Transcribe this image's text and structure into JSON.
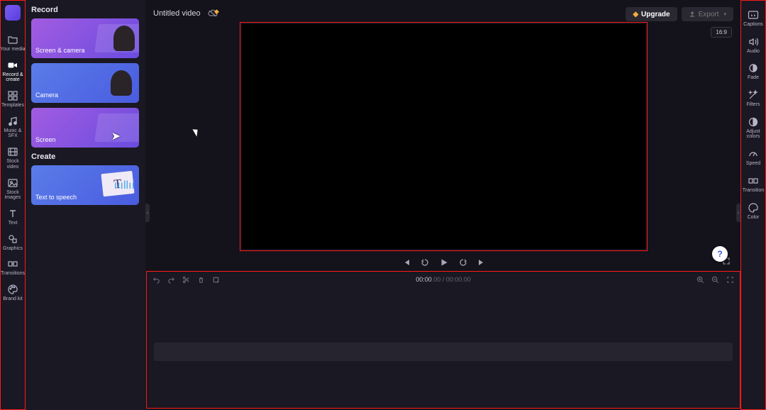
{
  "left_nav": {
    "items": [
      {
        "label": "Your media"
      },
      {
        "label": "Record & create"
      },
      {
        "label": "Templates"
      },
      {
        "label": "Music & SFX"
      },
      {
        "label": "Stock video"
      },
      {
        "label": "Stock images"
      },
      {
        "label": "Text"
      },
      {
        "label": "Graphics"
      },
      {
        "label": "Transitions"
      },
      {
        "label": "Brand kit"
      }
    ],
    "active_index": 1
  },
  "record_panel": {
    "heading_record": "Record",
    "heading_create": "Create",
    "screen_camera": "Screen & camera",
    "camera": "Camera",
    "screen": "Screen",
    "text_to_speech": "Text to speech"
  },
  "header": {
    "title": "Untitled video",
    "upgrade_label": "Upgrade",
    "export_label": "Export",
    "aspect_ratio": "16:9"
  },
  "right_nav": {
    "items": [
      {
        "label": "Captions"
      },
      {
        "label": "Audio"
      },
      {
        "label": "Fade"
      },
      {
        "label": "Filters"
      },
      {
        "label": "Adjust colors"
      },
      {
        "label": "Speed"
      },
      {
        "label": "Transition"
      },
      {
        "label": "Color"
      }
    ]
  },
  "timeline": {
    "current_mmss": "00:00",
    "current_ms": ".00",
    "separator": " / ",
    "total_mmss": "00:00",
    "total_ms": ".00"
  },
  "help": {
    "label": "?"
  },
  "colors": {
    "highlight": "#ff1a1a",
    "brand_gradient_a": "#7a5cf0",
    "brand_gradient_b": "#5a3ce0",
    "upgrade_diamond": "#f0b03a"
  }
}
